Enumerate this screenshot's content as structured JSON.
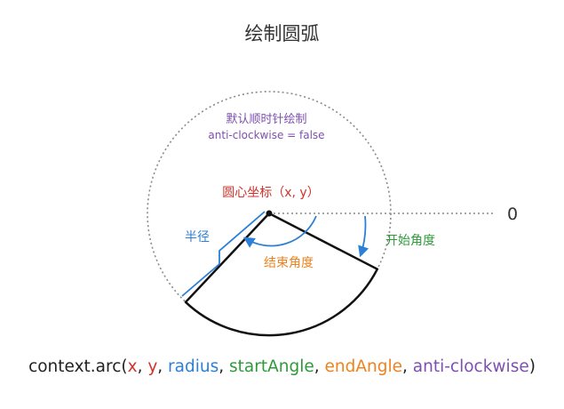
{
  "title": "绘制圆弧",
  "labels": {
    "direction_cn": "默认顺时针绘制",
    "direction_en": "anti-clockwise = false",
    "center": "圆心坐标（x, y）",
    "radius": "半径",
    "end_angle": "结束角度",
    "start_angle": "开始角度",
    "zero": "0"
  },
  "signature": {
    "func": "context.arc(",
    "x": "x",
    "y": "y",
    "radius": "radius",
    "start": "startAngle",
    "end": "endAngle",
    "anticlockwise": "anti-clockwise",
    "close": ")",
    "sep": ", "
  },
  "colors": {
    "title": "#333333",
    "purple": "#7d4fb0",
    "red": "#d0322b",
    "blue": "#2c7fd6",
    "green": "#2f9a3a",
    "orange": "#f0821e",
    "black": "#111111",
    "dotted": "#8a8a8a"
  }
}
